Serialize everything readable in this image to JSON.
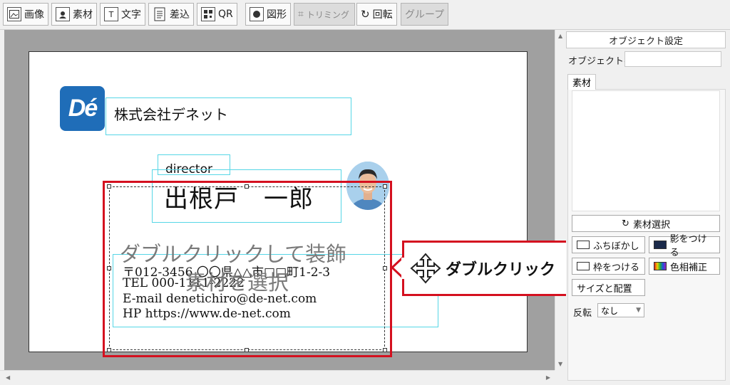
{
  "toolbar": {
    "image": "画像",
    "material": "素材",
    "text": "文字",
    "insert": "差込",
    "qr": "QR",
    "shape": "図形",
    "trim": "トリミング",
    "rotate": "回転",
    "group": "グループ"
  },
  "card": {
    "logo_text": "Dé",
    "company": "株式会社デネット",
    "role": "director",
    "person_name": "出根戸　一郎",
    "postal_address": "〒012-3456 〇〇県△△市□□町1-2-3",
    "tel": "TEL 000-1111-2222",
    "email": "E-mail denetichiro@de-net.com",
    "hp": "HP https://www.de-net.com",
    "placeholder_line1": "ダブルクリックして装飾",
    "placeholder_line2": "素材を選択"
  },
  "callout": {
    "label": "ダブルクリック"
  },
  "panel": {
    "title": "オブジェクト設定",
    "object_name_label": "オブジェクト名",
    "object_name_value": "",
    "tab_material": "素材",
    "select_material": "素材選択",
    "blur": "ふちぼかし",
    "shadow": "影をつける",
    "frame": "枠をつける",
    "hue": "色相補正",
    "size_position": "サイズと配置",
    "flip_label": "反転",
    "flip_value": "なし"
  },
  "colors": {
    "selection_red": "#d4101f",
    "guide_cyan": "#56d6e6",
    "logo_blue": "#1f6db8"
  }
}
